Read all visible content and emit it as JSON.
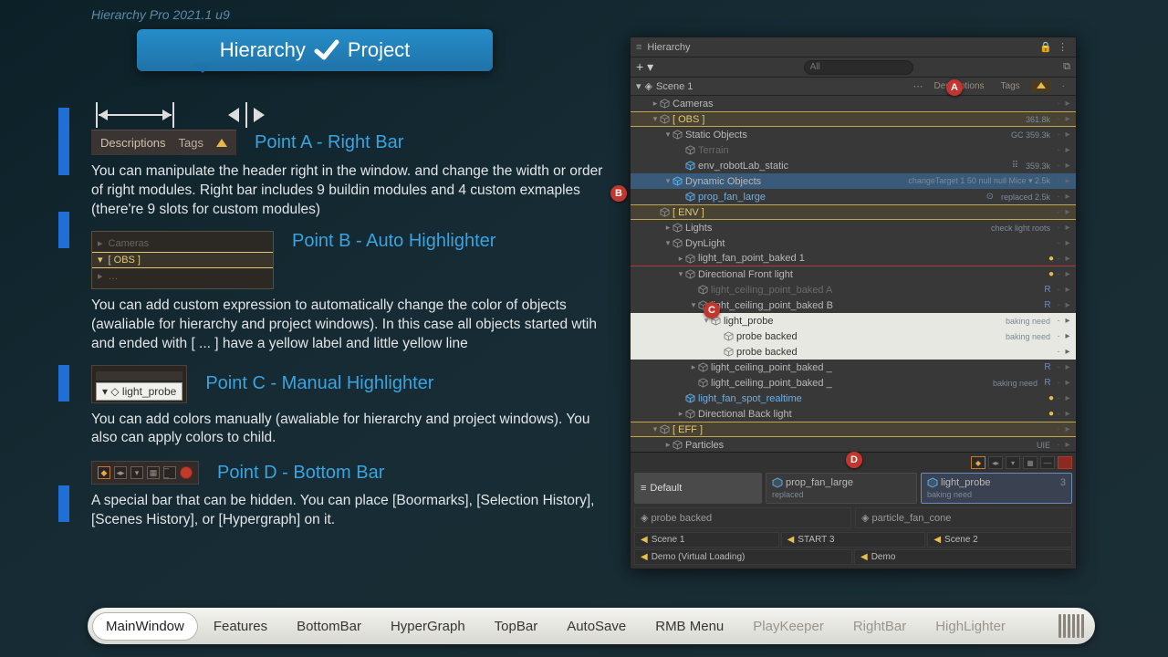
{
  "app_title": "Hierarchy Pro 2021.1 u9",
  "pill": {
    "left": "Hierarchy",
    "right": "Project"
  },
  "snips": {
    "bar": {
      "desc": "Descriptions",
      "tags": "Tags"
    },
    "b": {
      "cameras": "Cameras",
      "obs": "[ OBS ]"
    },
    "c": {
      "probe": "light_probe"
    }
  },
  "points": {
    "a": {
      "title": "Point A - Right Bar",
      "body": "You can manipulate the header right in the window. and change the width or order of right modules. Right bar includes 9 buildin modules and 4 custom exmaples (there're 9 slots for custom modules)"
    },
    "b": {
      "title": "Point B - Auto Highlighter",
      "body": "You can add custom expression to automatically change the color of objects (awaliable for hierarchy and project windows). In this case all objects started wtih and ended with [ ... ] have a yellow label and little yellow line"
    },
    "c": {
      "title": "Point C - Manual Highlighter",
      "body": "You can add colors manually (awaliable for hierarchy and project windows). You also can apply colors to child."
    },
    "d": {
      "title": "Point D - Bottom Bar",
      "body": "A special bar that can be hidden. You can place [Boormarks], [Selection History], [Scenes History], or [Hypergraph] on it."
    }
  },
  "panel": {
    "title": "Hierarchy",
    "search_placeholder": "All",
    "scene": "Scene 1",
    "cols": {
      "desc": "Descriptions",
      "tags": "Tags"
    },
    "rows": [
      {
        "d": 1,
        "t": "▸",
        "lbl": "Cameras"
      },
      {
        "d": 1,
        "t": "▾",
        "lbl": "[ OBS ]",
        "cls": "yellow",
        "meta": "361.8k"
      },
      {
        "d": 2,
        "t": "▾",
        "lbl": "Static Objects",
        "meta": "GC  359.3k"
      },
      {
        "d": 3,
        "t": "",
        "lbl": "Terrain",
        "gray": true
      },
      {
        "d": 3,
        "t": "",
        "lbl": "env_robotLab_static",
        "icon": "blue",
        "meta": "359.3k",
        "extra": "⠿"
      },
      {
        "d": 2,
        "t": "▾",
        "lbl": "Dynamic Objects",
        "cls": "bluebox",
        "icon": "blue",
        "meta": "changeTarget 1  50  null  null   Mice ▾      2.5k"
      },
      {
        "d": 3,
        "t": "",
        "lbl": "prop_fan_large",
        "icon": "blue",
        "blue": true,
        "meta": "replaced                         2.5k",
        "extra": "⊙"
      },
      {
        "d": 1,
        "t": "",
        "lbl": "[ ENV ]",
        "cls": "yellow"
      },
      {
        "d": 2,
        "t": "▸",
        "lbl": "Lights",
        "meta": "check light roots"
      },
      {
        "d": 2,
        "t": "▾",
        "lbl": "DynLight"
      },
      {
        "d": 3,
        "t": "▸",
        "lbl": "light_fan_point_baked 1",
        "bulb": true,
        "cls": "redline"
      },
      {
        "d": 3,
        "t": "▾",
        "lbl": "Directional Front light",
        "bulb": true
      },
      {
        "d": 4,
        "t": "",
        "lbl": "light_ceiling_point_baked A",
        "gray": true,
        "R": true
      },
      {
        "d": 4,
        "t": "▾",
        "lbl": "light_ceiling_point_baked B",
        "R": true
      },
      {
        "d": 5,
        "t": "▾",
        "lbl": "light_probe",
        "cls": "white",
        "meta": "baking need"
      },
      {
        "d": 6,
        "t": "",
        "lbl": "probe backed",
        "cls": "white",
        "meta": "baking need"
      },
      {
        "d": 6,
        "t": "",
        "lbl": "probe backed",
        "cls": "white"
      },
      {
        "d": 4,
        "t": "▸",
        "lbl": "light_ceiling_point_baked _",
        "R": true
      },
      {
        "d": 4,
        "t": "",
        "lbl": "light_ceiling_point_baked _",
        "meta": "baking need",
        "R": true
      },
      {
        "d": 3,
        "t": "",
        "lbl": "light_fan_spot_realtime",
        "icon": "blue",
        "blue": true,
        "bulb": true
      },
      {
        "d": 3,
        "t": "▸",
        "lbl": "Directional Back light",
        "bulb": true
      },
      {
        "d": 1,
        "t": "▾",
        "lbl": "[ EFF ]",
        "cls": "yellow"
      },
      {
        "d": 2,
        "t": "▸",
        "lbl": "Particles",
        "meta": "UIE"
      }
    ],
    "bottom": {
      "default": "Default",
      "cards": [
        {
          "name": "prop_fan_large",
          "sub": "replaced"
        },
        {
          "name": "light_probe",
          "sub": "baking need",
          "sel": true,
          "count": "3"
        }
      ],
      "wide": [
        "probe backed",
        "particle_fan_cone"
      ],
      "scenes": [
        "Scene 1",
        "START 3",
        "Scene 2",
        "Demo (Virtual Loading)",
        "Demo"
      ]
    }
  },
  "badges": {
    "A": "A",
    "B": "B",
    "C": "C",
    "D": "D"
  },
  "nav": [
    {
      "label": "MainWindow",
      "active": true
    },
    {
      "label": "Features"
    },
    {
      "label": "BottomBar"
    },
    {
      "label": "HyperGraph"
    },
    {
      "label": "TopBar"
    },
    {
      "label": "AutoSave"
    },
    {
      "label": "RMB Menu"
    },
    {
      "label": "PlayKeeper",
      "dim": true
    },
    {
      "label": "RightBar",
      "dim": true
    },
    {
      "label": "HighLighter",
      "dim": true
    }
  ]
}
